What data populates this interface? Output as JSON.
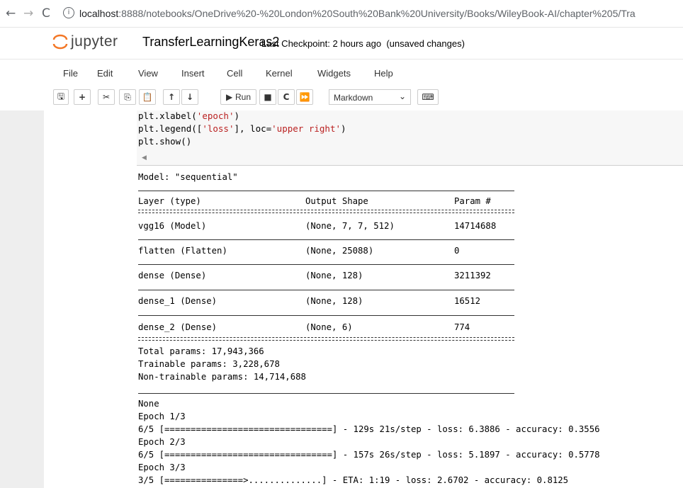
{
  "browser": {
    "back_icon": "back-arrow",
    "forward_icon": "forward-arrow",
    "reload_icon": "reload",
    "url_host": "localhost",
    "url_rest": ":8888/notebooks/OneDrive%20-%20London%20South%20Bank%20University/Books/WileyBook-AI/chapter%205/Tra"
  },
  "header": {
    "brand": "jupyter",
    "notebook_name": "TransferLearningKeras2",
    "checkpoint": "Last Checkpoint: 2 hours ago",
    "unsaved": "(unsaved changes)"
  },
  "menu": [
    "File",
    "Edit",
    "View",
    "Insert",
    "Cell",
    "Kernel",
    "Widgets",
    "Help"
  ],
  "toolbar": {
    "run_label": "Run",
    "cell_type": "Markdown"
  },
  "code": {
    "line1_a": "plt.xlabel(",
    "line1_str": "'epoch'",
    "line1_b": ")",
    "line2_a": "plt.legend([",
    "line2_str1": "'loss'",
    "line2_b": "], loc=",
    "line2_str2": "'upper right'",
    "line2_c": ")",
    "line3": "plt.show()"
  },
  "output": {
    "model_title": "Model: \"sequential\"",
    "headers": [
      "Layer (type)",
      "Output Shape",
      "Param #"
    ],
    "rows": [
      {
        "layer": "vgg16 (Model)",
        "shape": "(None, 7, 7, 512)",
        "params": "14714688"
      },
      {
        "layer": "flatten (Flatten)",
        "shape": "(None, 25088)",
        "params": "0"
      },
      {
        "layer": "dense (Dense)",
        "shape": "(None, 128)",
        "params": "3211392"
      },
      {
        "layer": "dense_1 (Dense)",
        "shape": "(None, 128)",
        "params": "16512"
      },
      {
        "layer": "dense_2 (Dense)",
        "shape": "(None, 6)",
        "params": "774"
      }
    ],
    "total": "Total params: 17,943,366",
    "trainable": "Trainable params: 3,228,678",
    "non_trainable": "Non-trainable params: 14,714,688",
    "none": "None",
    "epochs": [
      "Epoch 1/3",
      "6/5 [================================] - 129s 21s/step - loss: 6.3886 - accuracy: 0.3556",
      "Epoch 2/3",
      "6/5 [================================] - 157s 26s/step - loss: 5.1897 - accuracy: 0.5778",
      "Epoch 3/3",
      "3/5 [===============>..............] - ETA: 1:19 - loss: 2.6702 - accuracy: 0.8125"
    ]
  }
}
